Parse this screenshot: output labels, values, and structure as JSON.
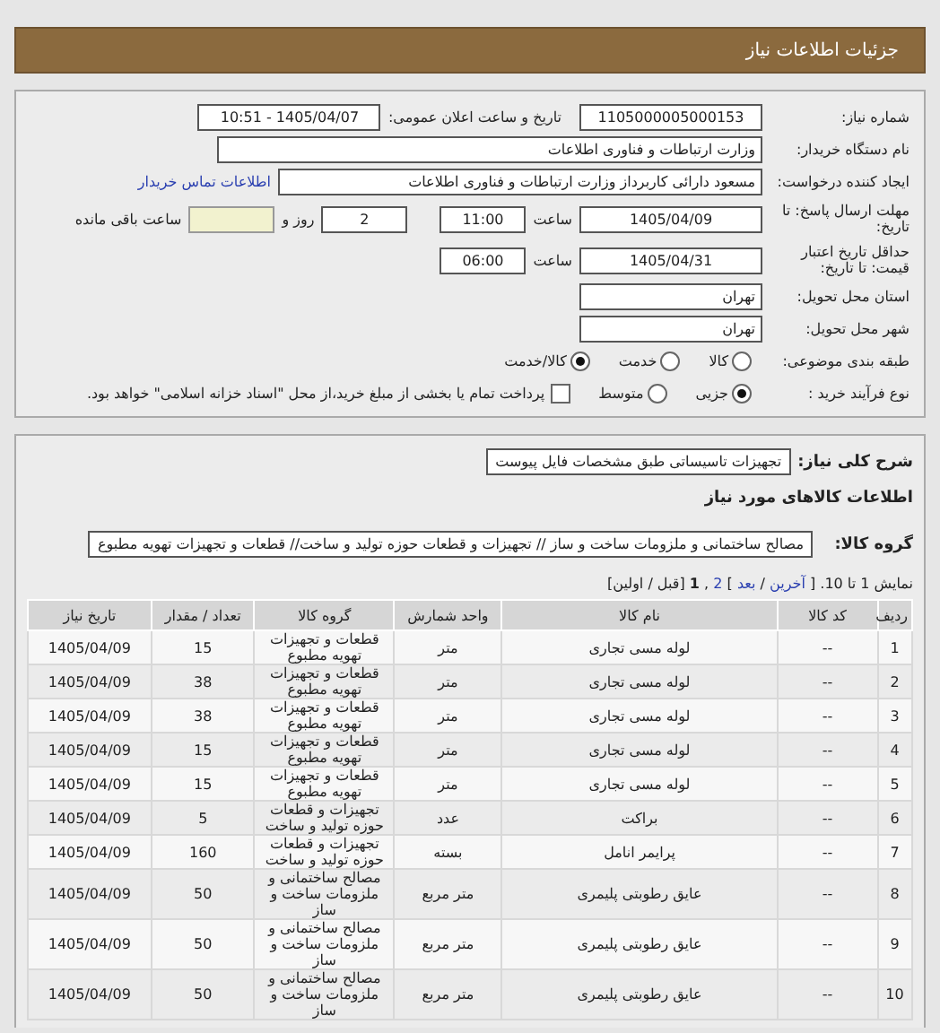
{
  "header": {
    "title": "جزئیات اطلاعات نیاز"
  },
  "details": {
    "need_number": {
      "label": "شماره نیاز:",
      "value": "1105000005000153"
    },
    "announce": {
      "label": "تاریخ و ساعت اعلان عمومی:",
      "value": "1405/04/07 - 10:51"
    },
    "buyer": {
      "label": "نام دستگاه خریدار:",
      "value": "وزارت ارتباطات و فناوری اطلاعات"
    },
    "requester": {
      "label": "ایجاد کننده درخواست:",
      "value": "مسعود دارائی کاربرداز وزارت ارتباطات و فناوری اطلاعات",
      "link": "اطلاعات تماس خریدار"
    },
    "reply_deadline": {
      "label": "مهلت ارسال پاسخ: تا تاریخ:",
      "date": "1405/04/09",
      "time_label": "ساعت",
      "time": "11:00",
      "days": "2",
      "days_label": "روز و",
      "remaining_label": "ساعت باقی مانده"
    },
    "price_validity": {
      "label": "حداقل تاریخ اعتبار قیمت: تا تاریخ:",
      "date": "1405/04/31",
      "time_label": "ساعت",
      "time": "06:00"
    },
    "province": {
      "label": "استان محل تحویل:",
      "value": "تهران"
    },
    "city": {
      "label": "شهر محل تحویل:",
      "value": "تهران"
    },
    "category": {
      "label": "طبقه بندی موضوعی:",
      "options": [
        {
          "label": "کالا",
          "selected": false
        },
        {
          "label": "خدمت",
          "selected": false
        },
        {
          "label": "کالا/خدمت",
          "selected": true
        }
      ]
    },
    "process": {
      "label": "نوع فرآیند خرید :",
      "options": [
        {
          "label": "جزیی",
          "selected": true
        },
        {
          "label": "متوسط",
          "selected": false
        }
      ],
      "payment": {
        "checked": false,
        "text": "پرداخت تمام یا بخشی از مبلغ خرید،از محل \"اسناد خزانه اسلامی\" خواهد بود."
      }
    }
  },
  "goods": {
    "description": {
      "label": "شرح کلی نیاز:",
      "value": "تجهیزات تاسیساتی طبق مشخصات فایل پیوست"
    },
    "section_title": "اطلاعات کالاهای مورد نیاز",
    "group": {
      "label": "گروه کالا:",
      "value": "مصالح ساختمانی و ملزومات ساخت و ساز // تجهیزات و قطعات حوزه تولید و ساخت// قطعات و تجهیزات تهویه مطبوع"
    },
    "pager": [
      {
        "kind": "text",
        "text": "نمایش 1 تا 10. ["
      },
      {
        "kind": "link",
        "text": "آخرین"
      },
      {
        "kind": "text",
        "text": "/"
      },
      {
        "kind": "link",
        "text": "بعد"
      },
      {
        "kind": "text",
        "text": "]"
      },
      {
        "kind": "link",
        "text": "2"
      },
      {
        "kind": "text",
        "text": ","
      },
      {
        "kind": "current",
        "text": "1"
      },
      {
        "kind": "text",
        "text": "[قبل / اولین]"
      }
    ],
    "table": {
      "columns": [
        "ردیف",
        "کد کالا",
        "نام کالا",
        "واحد شمارش",
        "گروه کالا",
        "تعداد / مقدار",
        "تاریخ نیاز"
      ],
      "rows": [
        [
          "1",
          "--",
          "لوله مسی تجاری",
          "متر",
          "قطعات و تجهیزات تهویه مطبوع",
          "15",
          "1405/04/09"
        ],
        [
          "2",
          "--",
          "لوله مسی تجاری",
          "متر",
          "قطعات و تجهیزات تهویه مطبوع",
          "38",
          "1405/04/09"
        ],
        [
          "3",
          "--",
          "لوله مسی تجاری",
          "متر",
          "قطعات و تجهیزات تهویه مطبوع",
          "38",
          "1405/04/09"
        ],
        [
          "4",
          "--",
          "لوله مسی تجاری",
          "متر",
          "قطعات و تجهیزات تهویه مطبوع",
          "15",
          "1405/04/09"
        ],
        [
          "5",
          "--",
          "لوله مسی تجاری",
          "متر",
          "قطعات و تجهیزات تهویه مطبوع",
          "15",
          "1405/04/09"
        ],
        [
          "6",
          "--",
          "براکت",
          "عدد",
          "تجهیزات و قطعات حوزه تولید و ساخت",
          "5",
          "1405/04/09"
        ],
        [
          "7",
          "--",
          "پرایمر انامل",
          "بسته",
          "تجهیزات و قطعات حوزه تولید و ساخت",
          "160",
          "1405/04/09"
        ],
        [
          "8",
          "--",
          "عایق رطوبتی پلیمری",
          "متر مربع",
          "مصالح ساختمانی و ملزومات ساخت و ساز",
          "50",
          "1405/04/09"
        ],
        [
          "9",
          "--",
          "عایق رطوبتی پلیمری",
          "متر مربع",
          "مصالح ساختمانی و ملزومات ساخت و ساز",
          "50",
          "1405/04/09"
        ],
        [
          "10",
          "--",
          "عایق رطوبتی پلیمری",
          "متر مربع",
          "مصالح ساختمانی و ملزومات ساخت و ساز",
          "50",
          "1405/04/09"
        ]
      ]
    }
  }
}
